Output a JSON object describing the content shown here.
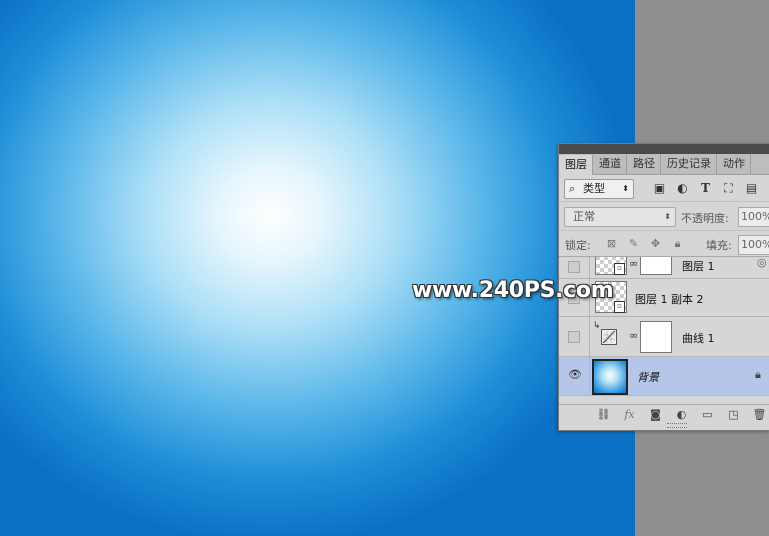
{
  "watermark": "www.240PS.com",
  "panel": {
    "tabs": [
      "图层",
      "通道",
      "路径",
      "历史记录",
      "动作"
    ],
    "kind_filter": "类型",
    "blend_mode": "正常",
    "opacity_label": "不透明度:",
    "opacity_value": "100%",
    "lock_label": "锁定:",
    "fill_label": "填充:",
    "fill_value": "100%",
    "layers": [
      {
        "name": "图层 1",
        "visible": false,
        "type": "smart-object-with-mask"
      },
      {
        "name": "图层 1 副本 2",
        "visible": false,
        "type": "smart-object",
        "clipped": true
      },
      {
        "name": "曲线 1",
        "visible": false,
        "type": "curves-adjustment",
        "clipped": true
      },
      {
        "name": "背景",
        "visible": true,
        "type": "background",
        "selected": true,
        "locked": true
      }
    ]
  },
  "colors": {
    "canvas_center": "#ffffff",
    "canvas_edge": "#0a70c4",
    "selected_layer": "#b5c6e8",
    "panel_bg": "#d6d6d6",
    "workspace_gray": "#909090"
  }
}
